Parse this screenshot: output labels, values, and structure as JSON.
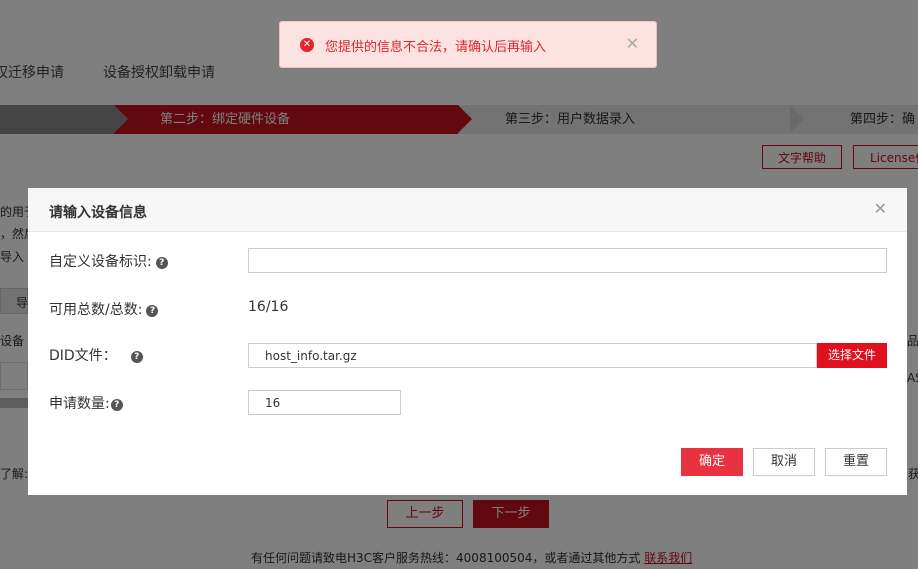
{
  "nav_tabs": [
    "权迁移申请",
    "设备授权卸载申请"
  ],
  "steps": {
    "active": "第二步：绑定硬件设备",
    "step3": "第三步：用户数据录入",
    "step4": "第四步：确"
  },
  "help_buttons": {
    "text_help": "文字帮助",
    "license": "License信"
  },
  "background_fragments": {
    "f1": "的用于",
    "f2": "，然后",
    "f3": "导入",
    "f4": "导",
    "f5": "设备",
    "f6": "品",
    "f7": "AS",
    "f8": "了解:",
    "f9": "获"
  },
  "bottom_nav": {
    "prev": "上一步",
    "next": "下一步"
  },
  "footer": {
    "text": "有任何问题请致电H3C客户服务热线：4008100504，或者通过其他方式",
    "link": "联系我们"
  },
  "toast": {
    "message": "您提供的信息不合法，请确认后再输入",
    "icon": "x-circle-icon",
    "color": "#e0252f"
  },
  "modal": {
    "title": "请输入设备信息",
    "fields": {
      "custom_id_label": "自定义设备标识:",
      "custom_id_value": "",
      "available_label": "可用总数/总数:",
      "available_value": "16/16",
      "did_label": "DID文件：",
      "did_value": "host_info.tar.gz",
      "did_button": "选择文件",
      "quantity_label": "申请数量:",
      "quantity_value": "16"
    },
    "buttons": {
      "ok": "确定",
      "cancel": "取消",
      "reset": "重置"
    }
  },
  "colors": {
    "brand_red": "#c4101e",
    "ok_button": "#e8323f"
  }
}
